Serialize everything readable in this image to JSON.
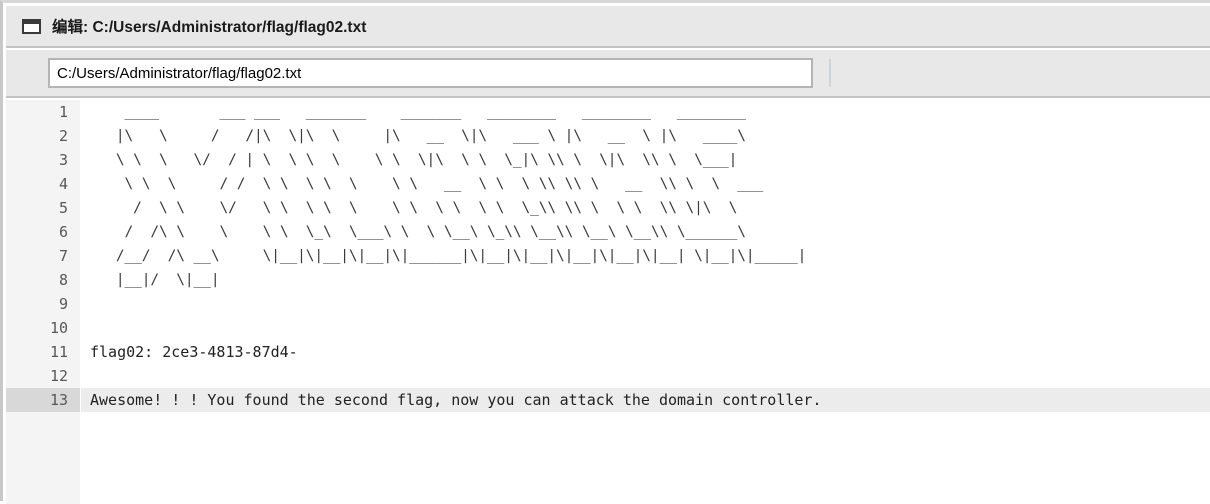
{
  "window": {
    "icon": "window-icon",
    "title_label": "编辑",
    "title_separator": ": ",
    "title_path": "C:/Users/Administrator/flag/flag02.txt",
    "title_full": "编辑: C:/Users/Administrator/flag/flag02.txt"
  },
  "toolbar": {
    "path_value": "C:/Users/Administrator/flag/flag02.txt",
    "path_placeholder": "C:/Users/Administrator/flag/flag02.txt"
  },
  "editor": {
    "active_line": 13,
    "line_numbers": [
      "1",
      "2",
      "3",
      "4",
      "5",
      "6",
      "7",
      "8",
      "9",
      "10",
      "11",
      "12",
      "13"
    ],
    "lines": [
      "    ____       ___ ___   _______    _______   ________   ________   ________",
      "   |\\   \\     /   /|\\  \\|\\  \\     |\\   __  \\|\\   ___ \\ |\\   __  \\ |\\   ____\\",
      "   \\ \\  \\   \\/  / | \\  \\ \\  \\    \\ \\  \\|\\  \\ \\  \\_|\\ \\\\ \\  \\|\\  \\\\ \\  \\___|",
      "    \\ \\  \\     / /  \\ \\  \\ \\  \\    \\ \\   __  \\ \\  \\ \\\\ \\\\ \\   __  \\\\ \\  \\  ___",
      "     /  \\ \\    \\/   \\ \\  \\ \\  \\    \\ \\  \\ \\  \\ \\  \\_\\\\ \\\\ \\  \\ \\  \\\\ \\|\\  \\",
      "    /  /\\ \\    \\    \\ \\  \\_\\  \\___\\ \\  \\ \\__\\ \\_\\\\ \\__\\\\ \\__\\ \\__\\\\ \\______\\",
      "   /__/  /\\ __\\     \\|__|\\|__|\\|__|\\|______|\\|__|\\|__|\\|__|\\|__|\\|__| \\|__|\\|_____|",
      "   |__|/  \\|__|",
      "",
      "",
      "flag02: 2ce3-4813-87d4-",
      "",
      "Awesome! ! ! You found the second flag, now you can attack the domain controller."
    ]
  }
}
